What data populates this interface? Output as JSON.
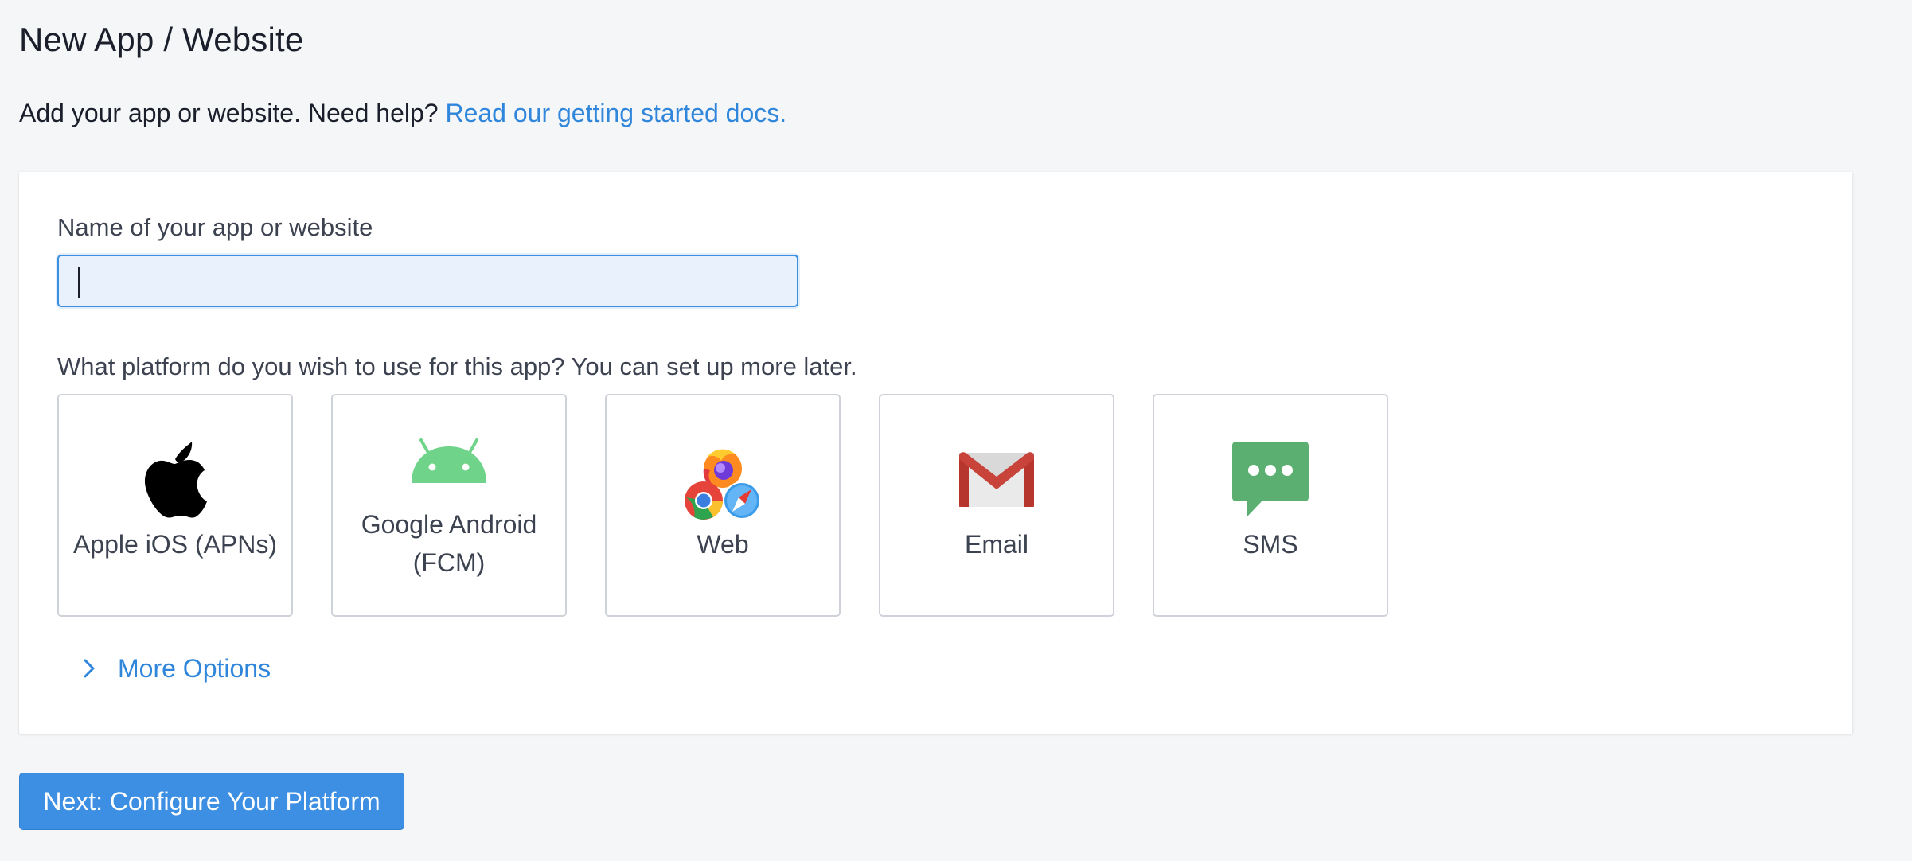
{
  "header": {
    "title": "New App / Website",
    "subtitle_text": "Add your app or website. Need help?",
    "subtitle_link": "Read our getting started docs."
  },
  "form": {
    "name_label": "Name of your app or website",
    "name_value": "",
    "name_placeholder": "",
    "platform_question": "What platform do you wish to use for this app? You can set up more later."
  },
  "platforms": [
    {
      "label": "Apple iOS (APNs)",
      "icon": "apple-icon"
    },
    {
      "label_line1": "Google Android",
      "label_line2": "(FCM)",
      "icon": "android-icon"
    },
    {
      "label": "Web",
      "icon": "web-browsers-icon"
    },
    {
      "label": "Email",
      "icon": "gmail-icon"
    },
    {
      "label": "SMS",
      "icon": "sms-chat-icon"
    }
  ],
  "more_options": {
    "label": "More Options",
    "expanded": false
  },
  "actions": {
    "next_label": "Next: Configure Your Platform"
  },
  "colors": {
    "accent": "#3d8fe3",
    "link": "#2f86db",
    "background": "#f5f6f8",
    "android_green": "#6fd389",
    "sms_green": "#5bb071",
    "gmail_red": "#c8433a"
  }
}
